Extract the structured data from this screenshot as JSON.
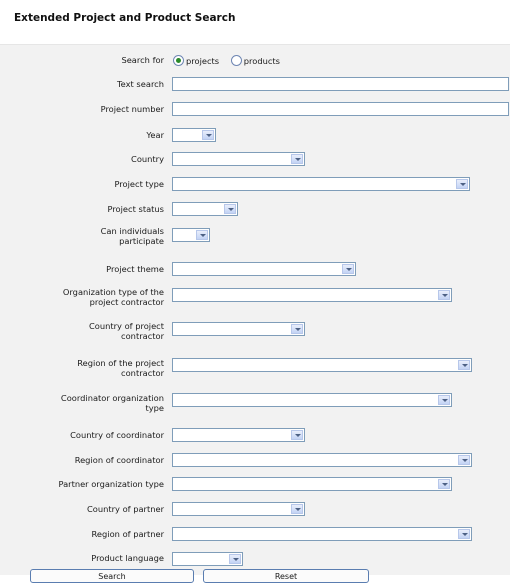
{
  "page": {
    "title": "Extended Project and Product Search"
  },
  "search_for": {
    "label": "Search for",
    "options": [
      {
        "label": "projects",
        "selected": true
      },
      {
        "label": "products",
        "selected": false
      }
    ]
  },
  "fields": {
    "text_search": {
      "label": "Text search",
      "value": ""
    },
    "project_number": {
      "label": "Project number",
      "value": ""
    },
    "year": {
      "label": "Year",
      "value": ""
    },
    "country": {
      "label": "Country",
      "value": ""
    },
    "project_type": {
      "label": "Project type",
      "value": ""
    },
    "project_status": {
      "label": "Project status",
      "value": ""
    },
    "can_individuals_participate": {
      "label_line1": "Can individuals",
      "label_line2": "participate",
      "value": ""
    },
    "project_theme": {
      "label": "Project theme",
      "value": ""
    },
    "org_type_contractor": {
      "label_line1": "Organization type of the",
      "label_line2": "project contractor",
      "value": ""
    },
    "country_contractor": {
      "label_line1": "Country of project",
      "label_line2": "contractor",
      "value": ""
    },
    "region_contractor": {
      "label_line1": "Region of the project",
      "label_line2": "contractor",
      "value": ""
    },
    "coordinator_org_type": {
      "label_line1": "Coordinator organization",
      "label_line2": "type",
      "value": ""
    },
    "country_coordinator": {
      "label": "Country of coordinator",
      "value": ""
    },
    "region_coordinator": {
      "label": "Region of coordinator",
      "value": ""
    },
    "partner_org_type": {
      "label": "Partner organization type",
      "value": ""
    },
    "country_partner": {
      "label": "Country of partner",
      "value": ""
    },
    "region_partner": {
      "label": "Region of partner",
      "value": ""
    },
    "product_language": {
      "label": "Product language",
      "value": ""
    }
  },
  "buttons": {
    "search": "Search",
    "reset": "Reset"
  }
}
